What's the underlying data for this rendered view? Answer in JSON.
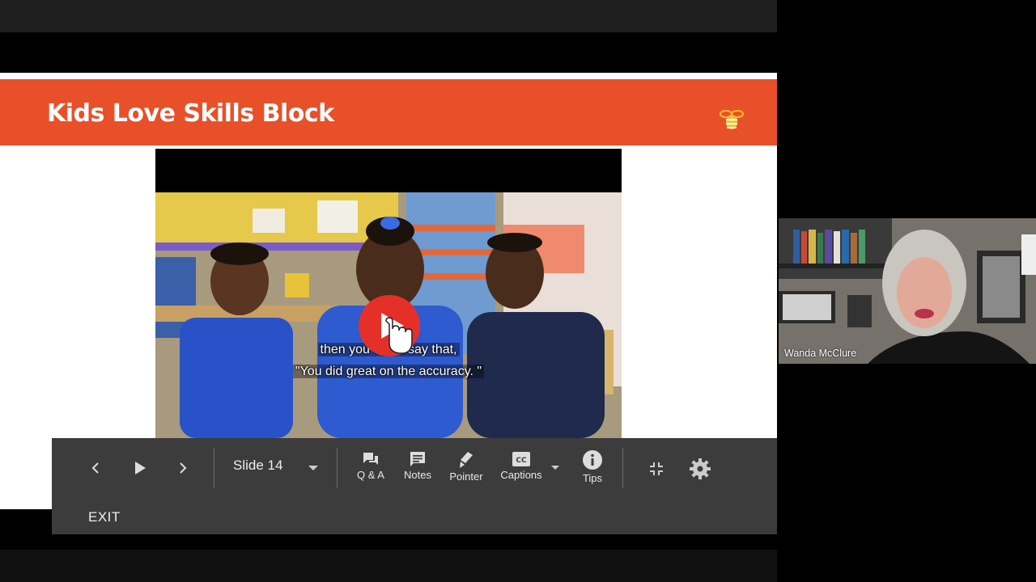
{
  "slide": {
    "title": "Kids Love Skills Block",
    "brand_color": "#e8502a"
  },
  "video": {
    "caption_line1": "then you could say that,",
    "caption_line2": "\"You did great on the accuracy. \""
  },
  "controls": {
    "current_slide": "Slide 14",
    "qa_label": "Q & A",
    "notes_label": "Notes",
    "pointer_label": "Pointer",
    "captions_label": "Captions",
    "tips_label": "Tips",
    "exit_label": "EXIT"
  },
  "participant": {
    "name": "Wanda McClure"
  },
  "icons": [
    "prev-icon",
    "play-icon",
    "next-icon",
    "qa-icon",
    "notes-icon",
    "pointer-icon",
    "cc-icon",
    "info-icon",
    "exit-fullscreen-icon",
    "gear-icon",
    "bee-logo-icon",
    "youtube-play-icon",
    "hand-cursor-icon"
  ]
}
